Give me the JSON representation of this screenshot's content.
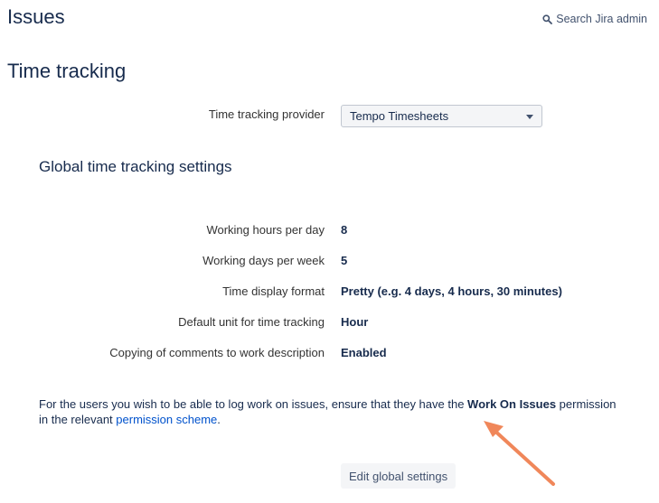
{
  "header": {
    "title": "Issues",
    "search_label": "Search Jira admin"
  },
  "section": {
    "title": "Time tracking"
  },
  "provider": {
    "label": "Time tracking provider",
    "selected": "Tempo Timesheets"
  },
  "global": {
    "title": "Global time tracking settings",
    "rows": [
      {
        "label": "Working hours per day",
        "value": "8"
      },
      {
        "label": "Working days per week",
        "value": "5"
      },
      {
        "label": "Time display format",
        "value": "Pretty (e.g. 4 days, 4 hours, 30 minutes)"
      },
      {
        "label": "Default unit for time tracking",
        "value": "Hour"
      },
      {
        "label": "Copying of comments to work description",
        "value": "Enabled"
      }
    ]
  },
  "note": {
    "prefix": "For the users you wish to be able to log work on issues, ensure that they have the ",
    "permission_name": "Work On Issues",
    "middle": " permission in the relevant ",
    "link_text": "permission scheme",
    "suffix": "."
  },
  "actions": {
    "edit_label": "Edit global settings"
  },
  "annotation": {
    "arrow_color": "#f0875a"
  }
}
